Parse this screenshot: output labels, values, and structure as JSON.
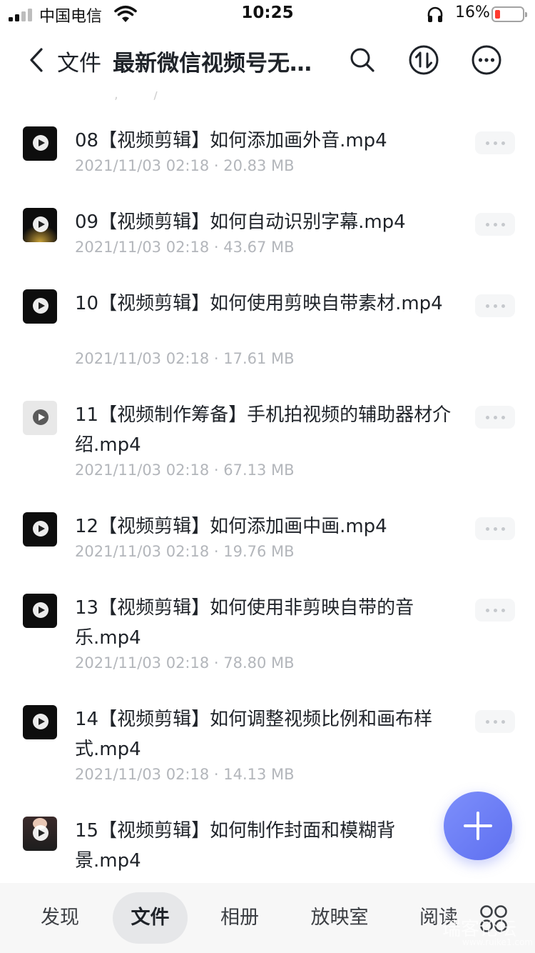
{
  "status_bar": {
    "carrier": "中国电信",
    "time": "10:25",
    "battery_percent": "16%"
  },
  "nav": {
    "back_label": "文件",
    "title": "最新微信视频号无…",
    "icons": [
      "back-icon",
      "search-icon",
      "sort-icon",
      "more-icon"
    ]
  },
  "files": [
    {
      "name": "08【视频剪辑】如何添加画外音.mp4",
      "date": "2021/11/03 02:18",
      "size": "20.83 MB",
      "thumb": "dark"
    },
    {
      "name": "09【视频剪辑】如何自动识别字幕.mp4",
      "date": "2021/11/03 02:18",
      "size": "43.67 MB",
      "thumb": "glow"
    },
    {
      "name": "10【视频剪辑】如何使用剪映自带素材.mp4",
      "date": "2021/11/03 02:18",
      "size": "17.61 MB",
      "thumb": "dark"
    },
    {
      "name": "11【视频制作筹备】手机拍视频的辅助器材介绍.mp4",
      "date": "2021/11/03 02:18",
      "size": "67.13 MB",
      "thumb": "light"
    },
    {
      "name": "12【视频剪辑】如何添加画中画.mp4",
      "date": "2021/11/03 02:18",
      "size": "19.76 MB",
      "thumb": "dark"
    },
    {
      "name": "13【视频剪辑】如何使用非剪映自带的音乐.mp4",
      "date": "2021/11/03 02:18",
      "size": "78.80 MB",
      "thumb": "dark"
    },
    {
      "name": "14【视频剪辑】如何调整视频比例和画布样式.mp4",
      "date": "2021/11/03 02:18",
      "size": "14.13 MB",
      "thumb": "dark"
    },
    {
      "name": "15【视频剪辑】如何制作封面和模糊背景.mp4",
      "date": "",
      "size": "",
      "thumb": "person"
    }
  ],
  "tabs": [
    "发现",
    "文件",
    "相册",
    "放映室",
    "阅读"
  ],
  "active_tab": "文件",
  "watermark": "瑞客论坛",
  "watermark_sub": "www.ruike1.com",
  "colors": {
    "accent": "#6a7bf5",
    "battery_low": "#ff3b30",
    "meta_text": "#b3b6bb"
  }
}
